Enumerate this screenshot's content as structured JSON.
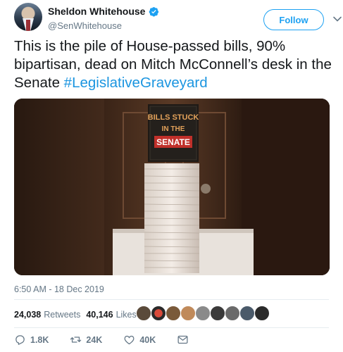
{
  "tweet": {
    "display_name": "Sheldon Whitehouse",
    "handle": "@SenWhitehouse",
    "follow_label": "Follow",
    "text_part1": "This is the pile of House-passed bills, 90% bipartisan, dead on Mitch McConnell’s desk in the Senate ",
    "hashtag": "#LegislativeGraveyard",
    "timestamp": "6:50 AM - 18 Dec 2019",
    "image_sign": {
      "line1": "BILLS STUCK",
      "line2": "IN THE",
      "line3": "SENATE"
    }
  },
  "stats": {
    "retweets_count": "24,038",
    "retweets_label": "Retweets",
    "likes_count": "40,146",
    "likes_label": "Likes"
  },
  "actions": {
    "replies": "1.8K",
    "retweets": "24K",
    "likes": "40K"
  },
  "colors": {
    "accent": "#1da1f2",
    "hashtag": "#1b95e0",
    "muted": "#657786"
  }
}
